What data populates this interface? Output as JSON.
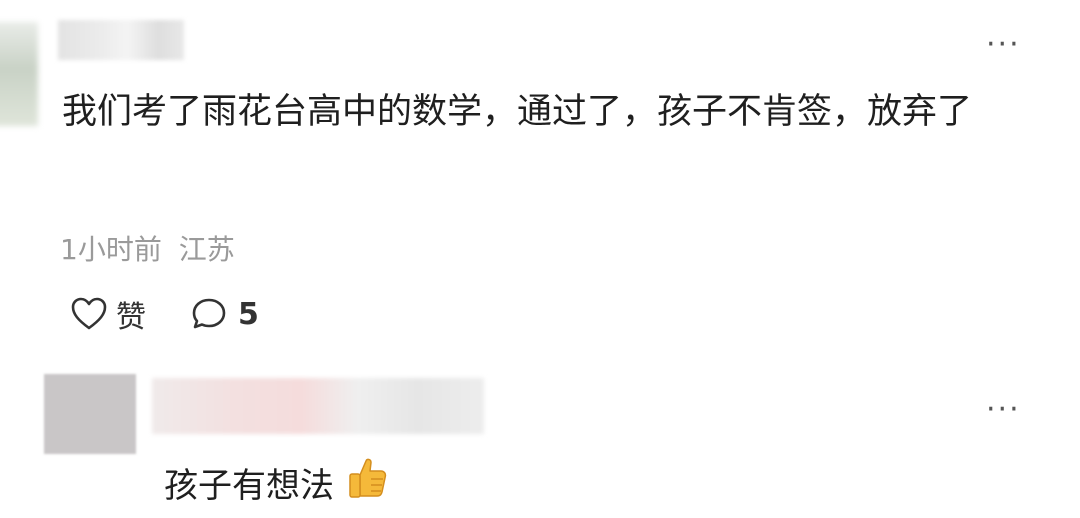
{
  "comment": {
    "text": "我们考了雨花台高中的数学，通过了，孩子不肯签，放弃了",
    "time": "1小时前",
    "location": "江苏",
    "like_label": "赞",
    "reply_count": "5",
    "more_label": "···"
  },
  "reply": {
    "text": "孩子有想法",
    "emoji": "thumbs-up-emoji",
    "more_label": "···"
  },
  "icons": [
    "heart-outline-icon",
    "comment-bubble-icon",
    "more-dots-icon",
    "thumbs-up-emoji"
  ]
}
